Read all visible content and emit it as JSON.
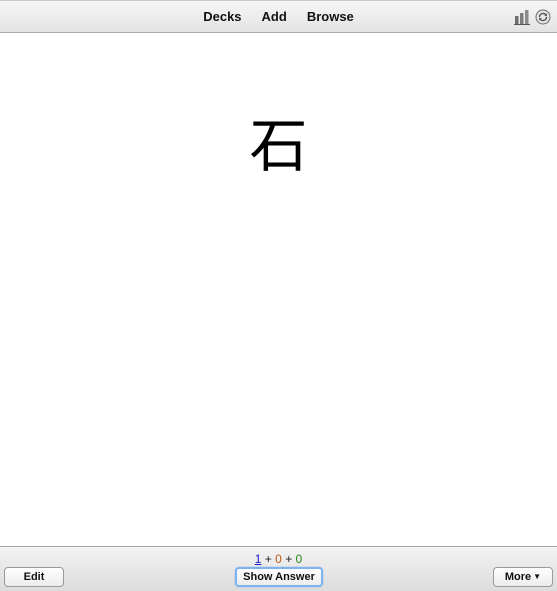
{
  "nav": {
    "decks": "Decks",
    "add": "Add",
    "browse": "Browse"
  },
  "toolbar_icons": [
    "stats-icon",
    "sync-icon"
  ],
  "card": {
    "question": "石"
  },
  "counts": {
    "new": "1",
    "learning": "0",
    "review": "0",
    "sep": "+"
  },
  "buttons": {
    "edit": "Edit",
    "show_answer": "Show Answer",
    "more": "More"
  },
  "colors": {
    "new": "#1a1acc",
    "learning": "#c35617",
    "review": "#238a1d",
    "focus_ring": "#7fb2f0"
  }
}
